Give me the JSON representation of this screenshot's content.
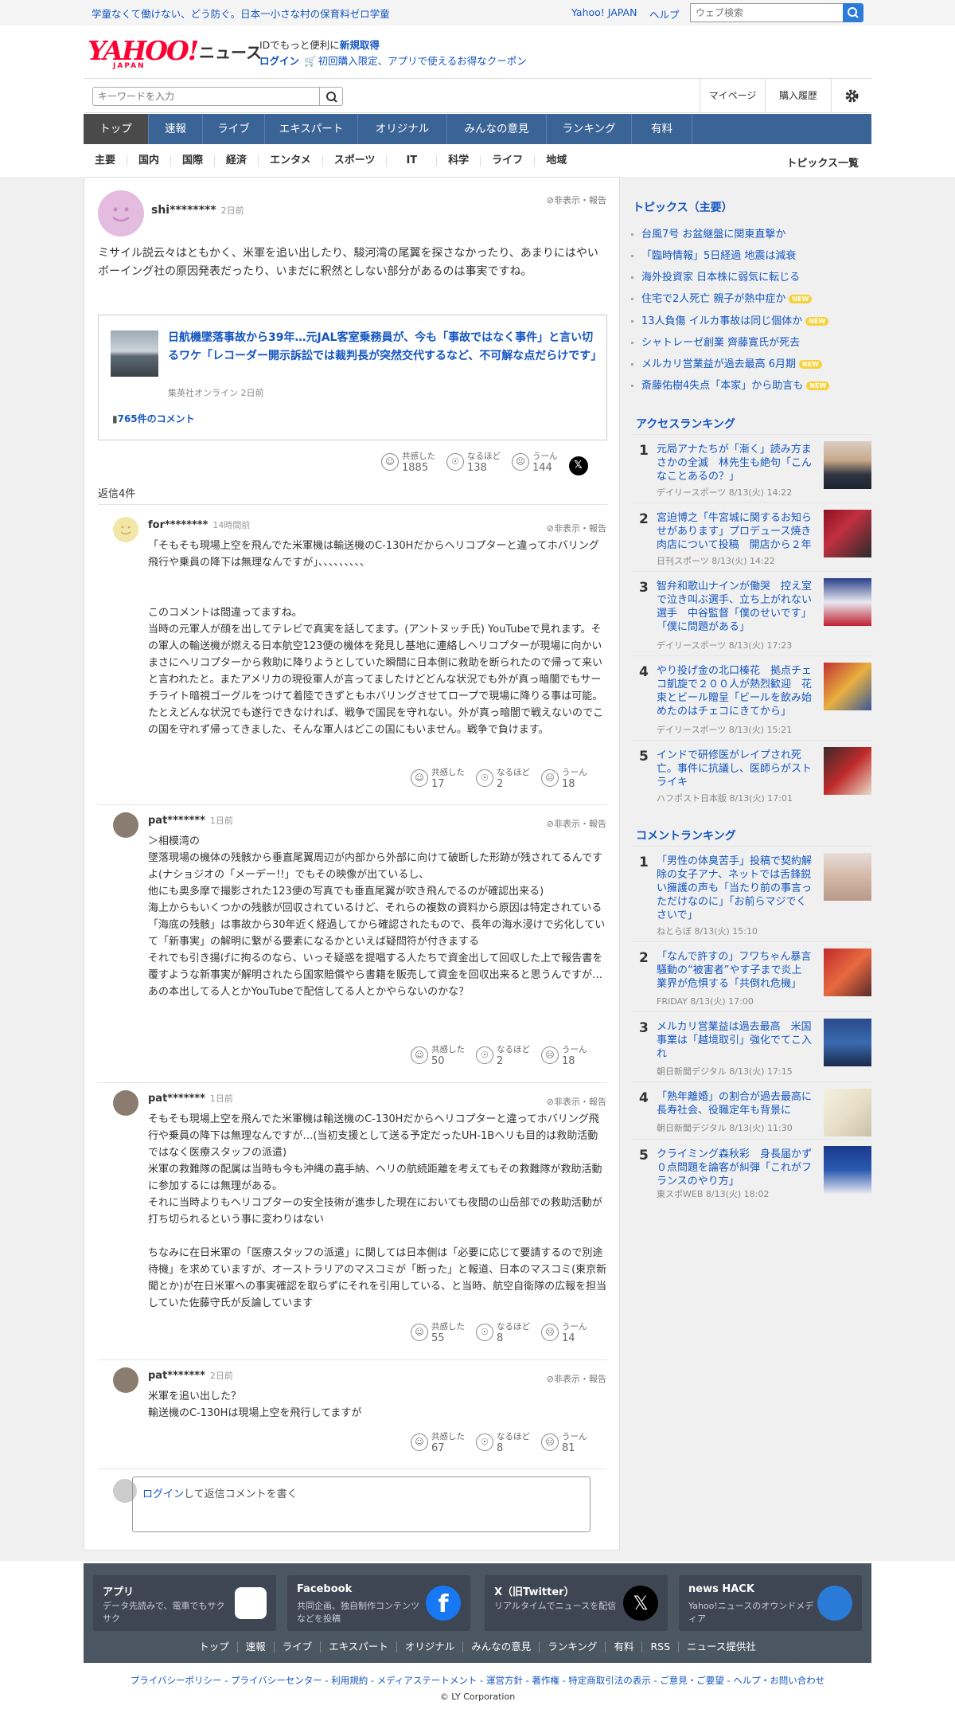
{
  "header": {
    "promo": "学童なくて働けない、どう防ぐ。日本一小さな村の保育料ゼロ学童",
    "yahoo_japan": "Yahoo! JAPAN",
    "help": "ヘルプ",
    "web_search_placeholder": "ウェブ検索",
    "logo_text": "YAHOO!",
    "logo_sub": "JAPAN",
    "news": "ニュース",
    "id_line_prefix": "IDでもっと便利に",
    "id_line_link": "新規取得",
    "login": "ログイン",
    "coupon": "初回購入限定、アプリで使えるお得なクーポン",
    "keyword_placeholder": "キーワードを入力",
    "mypage": "マイページ",
    "history": "購入履歴"
  },
  "main_nav": [
    "トップ",
    "速報",
    "ライブ",
    "エキスパート",
    "オリジナル",
    "みんなの意見",
    "ランキング",
    "有料"
  ],
  "sub_nav": [
    "主要",
    "国内",
    "国際",
    "経済",
    "エンタメ",
    "スポーツ",
    "IT",
    "科学",
    "ライフ",
    "地域"
  ],
  "topics_all": "トピックス一覧",
  "report_label": "非表示・報告",
  "reaction_labels": {
    "empathy": "共感した",
    "insight": "なるほど",
    "hmm": "うーん"
  },
  "comment": {
    "user": "shi********",
    "ago": "2日前",
    "text": "ミサイル説云々はともかく、米軍を追い出したり、駿河湾の尾翼を探さなかったり、あまりにはやいボーイング社の原因発表だったり、いまだに釈然としない部分があるのは事実ですね。",
    "article": {
      "title": "日航機墜落事故から39年…元JAL客室乗務員が、今も「事故ではなく事件」と言い切るワケ「レコーダー開示訴訟では裁判長が突然交代するなど、不可解な点だらけです」",
      "source": "集英社オンライン 2日前",
      "comments": "765件のコメント"
    },
    "empathy": "1885",
    "insight": "138",
    "hmm": "144"
  },
  "replies_count": "返信4件",
  "replies": [
    {
      "user": "for********",
      "ago": "14時間前",
      "text": "「そもそも現場上空を飛んでた米軍機は輸送機のC-130Hだからヘリコプターと違ってホバリング飛行や乗員の降下は無理なんですが」、、、、、、、、、\n\n\nこのコメントは間違ってますね。\n当時の元軍人が顔を出してテレビで真実を話してます。(アントヌッチ氏) YouTubeで見れます。その軍人の輸送機が燃える日本航空123便の機体を発見し基地に連絡しヘリコプターが現場に向かいまさにヘリコプターから救助に降りようとしていた瞬間に日本側に救助を断られたので帰って来いと言われたと。またアメリカの現役軍人が言ってましたけどどんな状況でも外が真っ暗闇でもサーチライト暗視ゴーグルをつけて着陸できずともホバリングさせてロープで現場に降りる事は可能。たとえどんな状況でも遂行できなければ、戦争で国民を守れない。外が真っ暗闇で戦えないのでこの国を守れず帰ってきました、そんな軍人はどこの国にもいません。戦争で負けます。",
      "empathy": "17",
      "insight": "2",
      "hmm": "18"
    },
    {
      "user": "pat*******",
      "ago": "1日前",
      "text": "＞相模湾の\n墜落現場の機体の残骸から垂直尾翼周辺が内部から外部に向けて破断した形跡が残されてるんですよ(ナショジオの「メーデー!!」でもその映像が出ているし、\n他にも奥多摩で撮影された123便の写真でも垂直尾翼が吹き飛んでるのが確認出来る)\n海上からもいくつかの残骸が回収されているけど、それらの複数の資料から原因は特定されている\n「海底の残骸」は事故から30年近く経過してから確認されたもので、長年の海水浸けで劣化していて「新事実」の解明に繋がる要素になるかといえば疑問符が付きまする\nそれでも引き揚げに拘るのなら、いっそ疑惑を提唱する人たちで資金出して回収した上で報告書を覆すような新事実が解明されたら国家賠償やら書籍を販売して資金を回収出来ると思うんですが…\nあの本出してる人とかYouTubeで配信してる人とかやらないのかな？",
      "empathy": "50",
      "insight": "2",
      "hmm": "18"
    },
    {
      "user": "pat*******",
      "ago": "1日前",
      "text": "そもそも現場上空を飛んでた米軍機は輸送機のC-130Hだからヘリコプターと違ってホバリング飛行や乗員の降下は無理なんですが…(当初支援として送る予定だったUH-1Bヘリも目的は救助活動ではなく医療スタッフの派遣)\n米軍の救難隊の配属は当時も今も沖縄の嘉手納、ヘリの航続距離を考えてもその救難隊が救助活動に参加するには無理がある。\nそれに当時よりもヘリコプターの安全技術が進歩した現在においても夜間の山岳部での救助活動が打ち切られるという事に変わりはない\n\nちなみに在日米軍の「医療スタッフの派遣」に関しては日本側は「必要に応じて要請するので別途待機」を求めていますが、オーストラリアのマスコミが「断った」と報道、日本のマスコミ(東京新聞とか)が在日米軍への事実確認を取らずにそれを引用している、と当時、航空自衛隊の広報を担当していた佐藤守氏が反論しています",
      "empathy": "55",
      "insight": "8",
      "hmm": "14"
    },
    {
      "user": "pat*******",
      "ago": "2日前",
      "text": "米軍を追い出した？\n輸送機のC-130Hは現場上空を飛行してますが",
      "empathy": "67",
      "insight": "8",
      "hmm": "81"
    }
  ],
  "reply_box": {
    "login": "ログイン",
    "rest": "して返信コメントを書く"
  },
  "topics": {
    "title": "トピックス（主要）",
    "items": [
      {
        "text": "台風7号 お盆継盤に関東直撃か",
        "new": ""
      },
      {
        "text": "「臨時情報」5日経過 地震は減衰",
        "new": ""
      },
      {
        "text": "海外投資家 日本株に弱気に転じる",
        "new": ""
      },
      {
        "text": "住宅で2人死亡 親子が熱中症か",
        "new": "NEW"
      },
      {
        "text": "13人負傷 イルカ事故は同じ個体か",
        "new": "NEW"
      },
      {
        "text": "シャトレーゼ創業 齊藤寛氏が死去",
        "new": ""
      },
      {
        "text": "メルカリ営業益が過去最高 6月期",
        "new": "NEW"
      },
      {
        "text": "斎藤佑樹4失点「本家」から助言も",
        "new": "NEW"
      }
    ]
  },
  "access_ranking": {
    "title": "アクセスランキング",
    "items": [
      {
        "rank": "1",
        "title": "元局アナたちが「漸く」読み方まさかの全滅　林先生も絶句「こんなことあるの？」",
        "meta": "デイリースポーツ 8/13(火) 14:22"
      },
      {
        "rank": "2",
        "title": "宮迫博之「牛宮城に関するお知らせがあります」プロデュース焼き肉店について投稿　開店から２年",
        "meta": "日刊スポーツ 8/13(火) 14:22"
      },
      {
        "rank": "3",
        "title": "智弁和歌山ナインが働哭　控え室で泣き叫ぶ選手、立ち上がれない選手　中谷監督「僕のせいです」「僕に問題がある」",
        "meta": "デイリースポーツ 8/13(火) 17:23"
      },
      {
        "rank": "4",
        "title": "やり投げ金の北口榛花　拠点チェコ凱旋で２００人が熱烈歓迎　花束とビール贈呈「ビールを飲み始めたのはチェコにきてから」",
        "meta": "デイリースポーツ 8/13(火) 15:21"
      },
      {
        "rank": "5",
        "title": "インドで研修医がレイプされ死亡。事件に抗議し、医師らがストライキ",
        "meta": "ハフポスト日本版 8/13(火) 17:01"
      }
    ]
  },
  "comment_ranking": {
    "title": "コメントランキング",
    "items": [
      {
        "rank": "1",
        "title": "「男性の体臭苦手」投稿で契約解除の女子アナ、ネットでは舌鋒鋭い擁護の声も「当たり前の事言っただけなのに」「お前らマジでくさいで」",
        "meta": "ねとらぼ 8/13(火) 15:10"
      },
      {
        "rank": "2",
        "title": "「なんで許すの」フワちゃん暴言騒動の“被害者”やす子まで炎上　業界が危惧する「共倒れ危機」",
        "meta": "FRIDAY 8/13(火) 17:00"
      },
      {
        "rank": "3",
        "title": "メルカリ営業益は過去最高　米国事業は「越境取引」強化でてこ入れ",
        "meta": "朝日新聞デジタル 8/13(火) 17:15"
      },
      {
        "rank": "4",
        "title": "「熟年離婚」の割合が過去最高に 長寿社会、役職定年も背景に",
        "meta": "朝日新聞デジタル 8/13(火) 11:30"
      },
      {
        "rank": "5",
        "title": "クライミング森秋彩　身長届かず０点問題を論客が糾弾「これがフランスのやり方」",
        "meta": "東スポWEB 8/13(火) 18:02"
      }
    ]
  },
  "footer": {
    "boxes": [
      {
        "title": "アプリ",
        "desc": "データ先読みで、電車でもサクサク"
      },
      {
        "title": "Facebook",
        "desc": "共同企画、独自制作コンテンツなどを投稿"
      },
      {
        "title": "X（旧Twitter）",
        "desc": "リアルタイムでニュースを配信"
      },
      {
        "title": "news HACK",
        "desc": "Yahoo!ニュースのオウンドメディア"
      }
    ],
    "nav": [
      "トップ",
      "速報",
      "ライブ",
      "エキスパート",
      "オリジナル",
      "みんなの意見",
      "ランキング",
      "有料",
      "RSS",
      "ニュース提供社"
    ],
    "links": "プライバシーポリシー - プライバシーセンター - 利用規約 - メディアステートメント - 運営方針 - 著作権 - 特定商取引法の表示 - ご意見・ご要望 - ヘルプ・お問い合わせ",
    "copyright": "© LY Corporation"
  },
  "colors": {
    "brand": "#ff0033",
    "link": "#1556c0",
    "nav": "#3b6496",
    "nav_active": "#4a4a4a",
    "footer": "#4b5663"
  }
}
